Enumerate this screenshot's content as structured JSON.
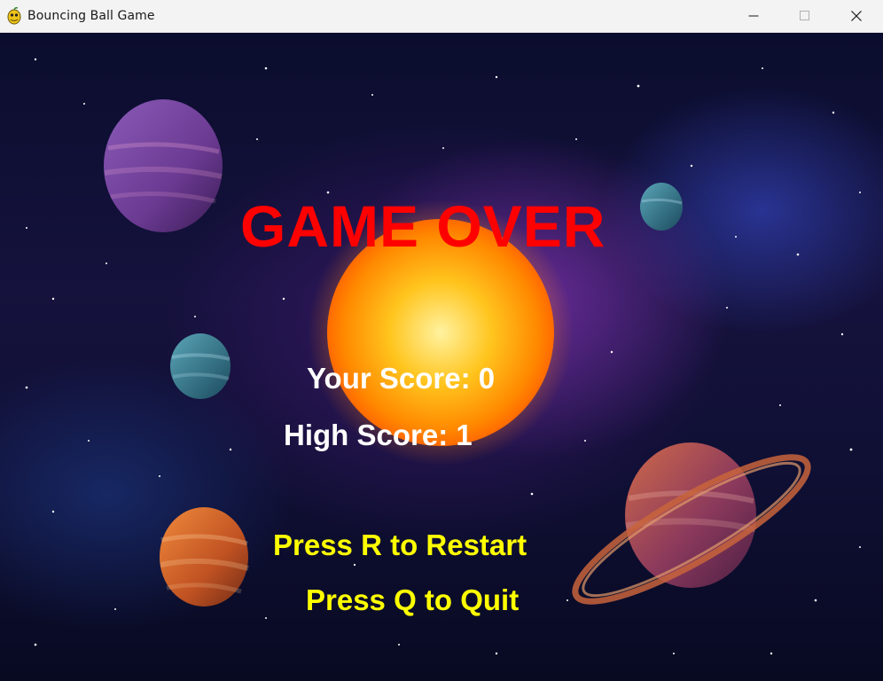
{
  "window": {
    "title": "Bouncing Ball Game",
    "controls": [
      "minimize",
      "maximize",
      "close"
    ],
    "app_icon": "pygame-snake-icon"
  },
  "game": {
    "headline": "GAME OVER",
    "your_score": "Your Score: 0",
    "high_score": "High Score: 1",
    "restart_hint": "Press R to Restart",
    "quit_hint": "Press Q to Quit"
  },
  "colors": {
    "headline": "#ff0000",
    "scores": "#ffffff",
    "hints": "#ffff00",
    "titlebar": "#f3f3f3"
  }
}
